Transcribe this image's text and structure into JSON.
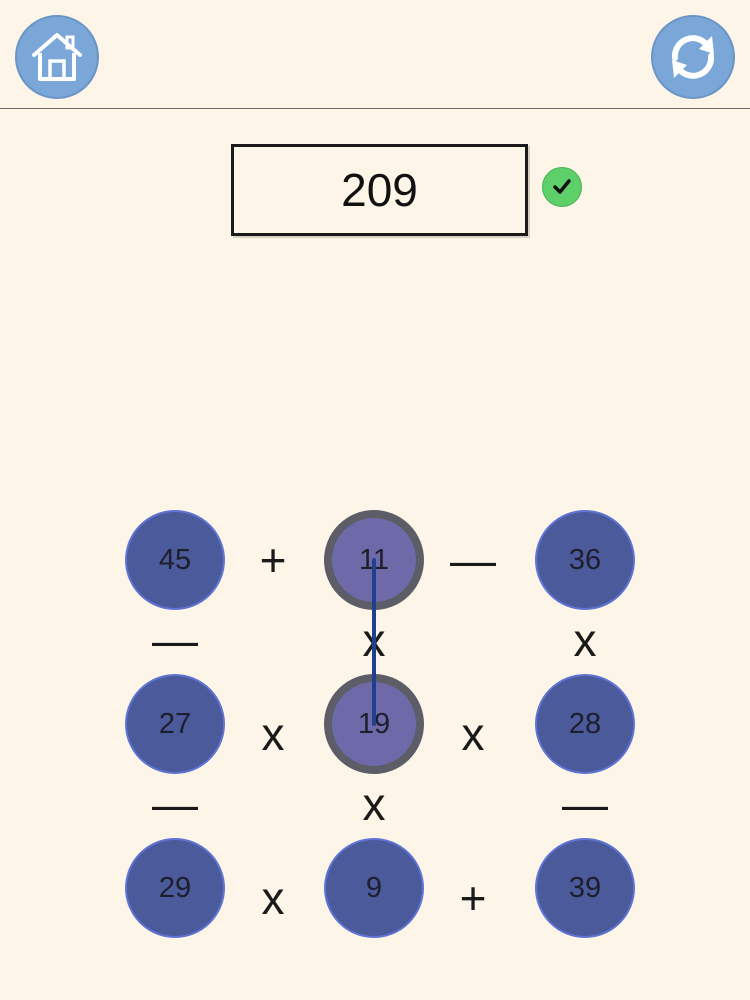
{
  "header": {
    "home_icon": "home-icon",
    "refresh_icon": "refresh-icon",
    "button_color": "#7aa6d8"
  },
  "target": {
    "value": "209",
    "status_icon": "check-icon",
    "status_color": "#5ed06a"
  },
  "grid": {
    "cell_color": "#4a5a9b",
    "selected_color": "#6e6aa9",
    "rows": [
      [
        "45",
        "11",
        "36"
      ],
      [
        "27",
        "19",
        "28"
      ],
      [
        "29",
        "9",
        "39"
      ]
    ],
    "horizontal_ops": [
      [
        "+",
        "—"
      ],
      [
        "x",
        "x"
      ],
      [
        "x",
        "+"
      ]
    ],
    "vertical_ops": [
      [
        "—",
        "x",
        "x"
      ],
      [
        "—",
        "x",
        "—"
      ]
    ],
    "selected_cells": [
      "11",
      "19"
    ],
    "link_color": "#1f3f8f"
  }
}
